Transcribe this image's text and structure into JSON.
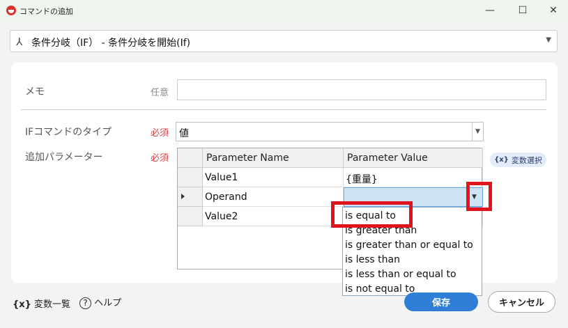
{
  "window": {
    "title": "コマンドの追加",
    "minimize_glyph": "—",
    "maximize_glyph": "☐",
    "close_glyph": "✕"
  },
  "command_select": {
    "icon": "branch-icon",
    "value": "条件分岐（IF） - 条件分岐を開始(If)"
  },
  "form": {
    "memo": {
      "label": "メモ",
      "tag": "任意",
      "value": ""
    },
    "if_type": {
      "label": "IFコマンドのタイプ",
      "tag": "必須",
      "value": "値"
    },
    "params": {
      "label": "追加パラメーター",
      "tag": "必須"
    }
  },
  "grid": {
    "headers": [
      "Parameter Name",
      "Parameter Value"
    ],
    "rows": [
      {
        "name": "Value1",
        "value": "{重量}"
      },
      {
        "name": "Operand",
        "value": ""
      },
      {
        "name": "Value2",
        "value": ""
      }
    ]
  },
  "variable_select_button": {
    "icon_text": "{x}",
    "label": "変数選択"
  },
  "operand_options": [
    "is equal to",
    "is greater than",
    "is greater than or equal to",
    "is less than",
    "is less than or equal to",
    "is not equal to"
  ],
  "footer": {
    "var_list": {
      "icon_text": "{x}",
      "label": "変数一覧"
    },
    "help": {
      "icon_text": "?",
      "label": "ヘルプ"
    },
    "save_label": "保存",
    "cancel_label": "キャンセル"
  },
  "colors": {
    "accent": "#2f7fd6",
    "highlight": "#e0141c",
    "required": "#d84040"
  }
}
